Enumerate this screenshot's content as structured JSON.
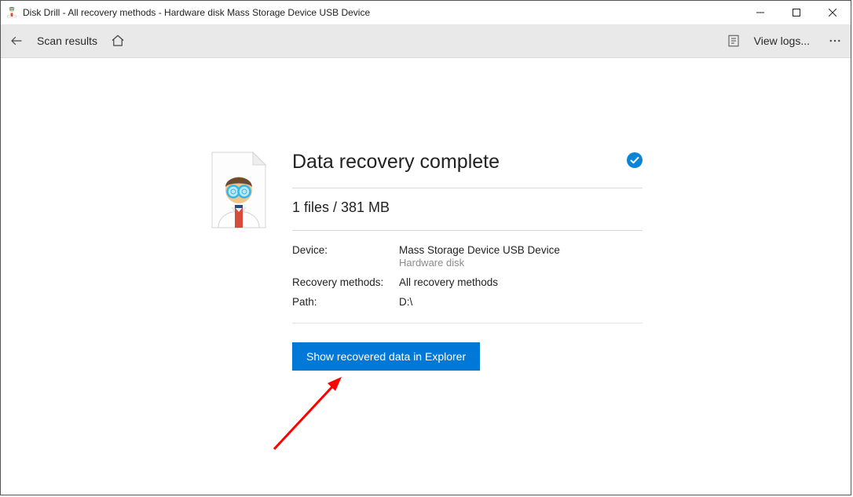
{
  "window": {
    "title": "Disk Drill - All recovery methods - Hardware disk Mass Storage Device USB Device"
  },
  "toolbar": {
    "scan_results": "Scan results",
    "view_logs": "View logs..."
  },
  "result": {
    "heading": "Data recovery complete",
    "summary": "1 files / 381 MB",
    "device_label": "Device:",
    "device_value": "Mass Storage Device USB Device",
    "device_sub": "Hardware disk",
    "methods_label": "Recovery methods:",
    "methods_value": "All recovery methods",
    "path_label": "Path:",
    "path_value": "D:\\",
    "button": "Show recovered data in Explorer"
  }
}
